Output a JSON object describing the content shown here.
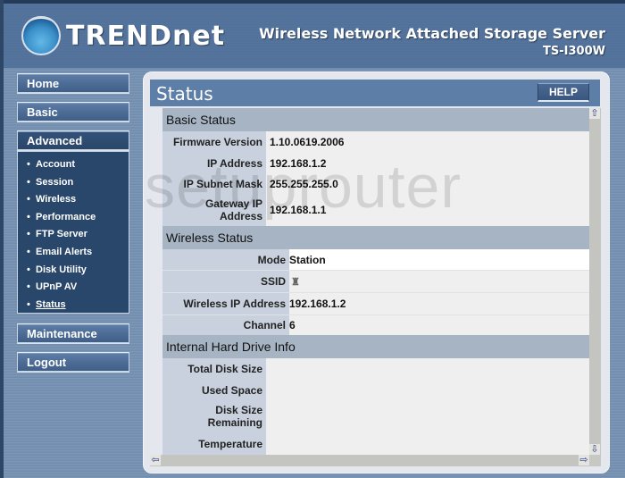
{
  "header": {
    "brand": "TRENDnet",
    "product_title": "Wireless Network Attached Storage Server",
    "model": "TS-I300W"
  },
  "sidebar": {
    "buttons": [
      {
        "label": "Home"
      },
      {
        "label": "Basic"
      },
      {
        "label": "Advanced"
      },
      {
        "label": "Maintenance"
      },
      {
        "label": "Logout"
      }
    ],
    "advanced_items": [
      {
        "label": "Account"
      },
      {
        "label": "Session"
      },
      {
        "label": "Wireless"
      },
      {
        "label": "Performance"
      },
      {
        "label": "FTP Server"
      },
      {
        "label": "Email Alerts"
      },
      {
        "label": "Disk Utility"
      },
      {
        "label": "UPnP AV"
      },
      {
        "label": "Status"
      }
    ],
    "current_item": "Status"
  },
  "panel": {
    "title": "Status",
    "help_label": "HELP"
  },
  "basic_status": {
    "heading": "Basic Status",
    "rows": [
      {
        "label": "Firmware Version",
        "value": "1.10.0619.2006"
      },
      {
        "label": "IP Address",
        "value": "192.168.1.2"
      },
      {
        "label": "IP Subnet Mask",
        "value": "255.255.255.0"
      },
      {
        "label": "Gateway IP Address",
        "value": "192.168.1.1"
      }
    ]
  },
  "wireless_status": {
    "heading": "Wireless Status",
    "rows": [
      {
        "label": "Mode",
        "value": "Station"
      },
      {
        "label": "SSID",
        "value": ""
      },
      {
        "label": "Wireless IP Address",
        "value": "192.168.1.2"
      },
      {
        "label": "Channel",
        "value": "6"
      }
    ]
  },
  "disk_info": {
    "heading": "Internal Hard Drive Info",
    "rows": [
      {
        "label": "Total Disk Size",
        "value": ""
      },
      {
        "label": "Used Space",
        "value": ""
      },
      {
        "label": "Disk Size Remaining",
        "value": ""
      },
      {
        "label": "Temperature",
        "value": ""
      }
    ]
  },
  "watermark": "setuprouter",
  "colors": {
    "header_bg": "#5274a0",
    "nav_button": "#4d6d97",
    "submenu_bg": "#29476a",
    "titlebar": "#5d7ea6",
    "section_heading": "#a7b4c4",
    "label_cell": "#c8d1dd"
  }
}
